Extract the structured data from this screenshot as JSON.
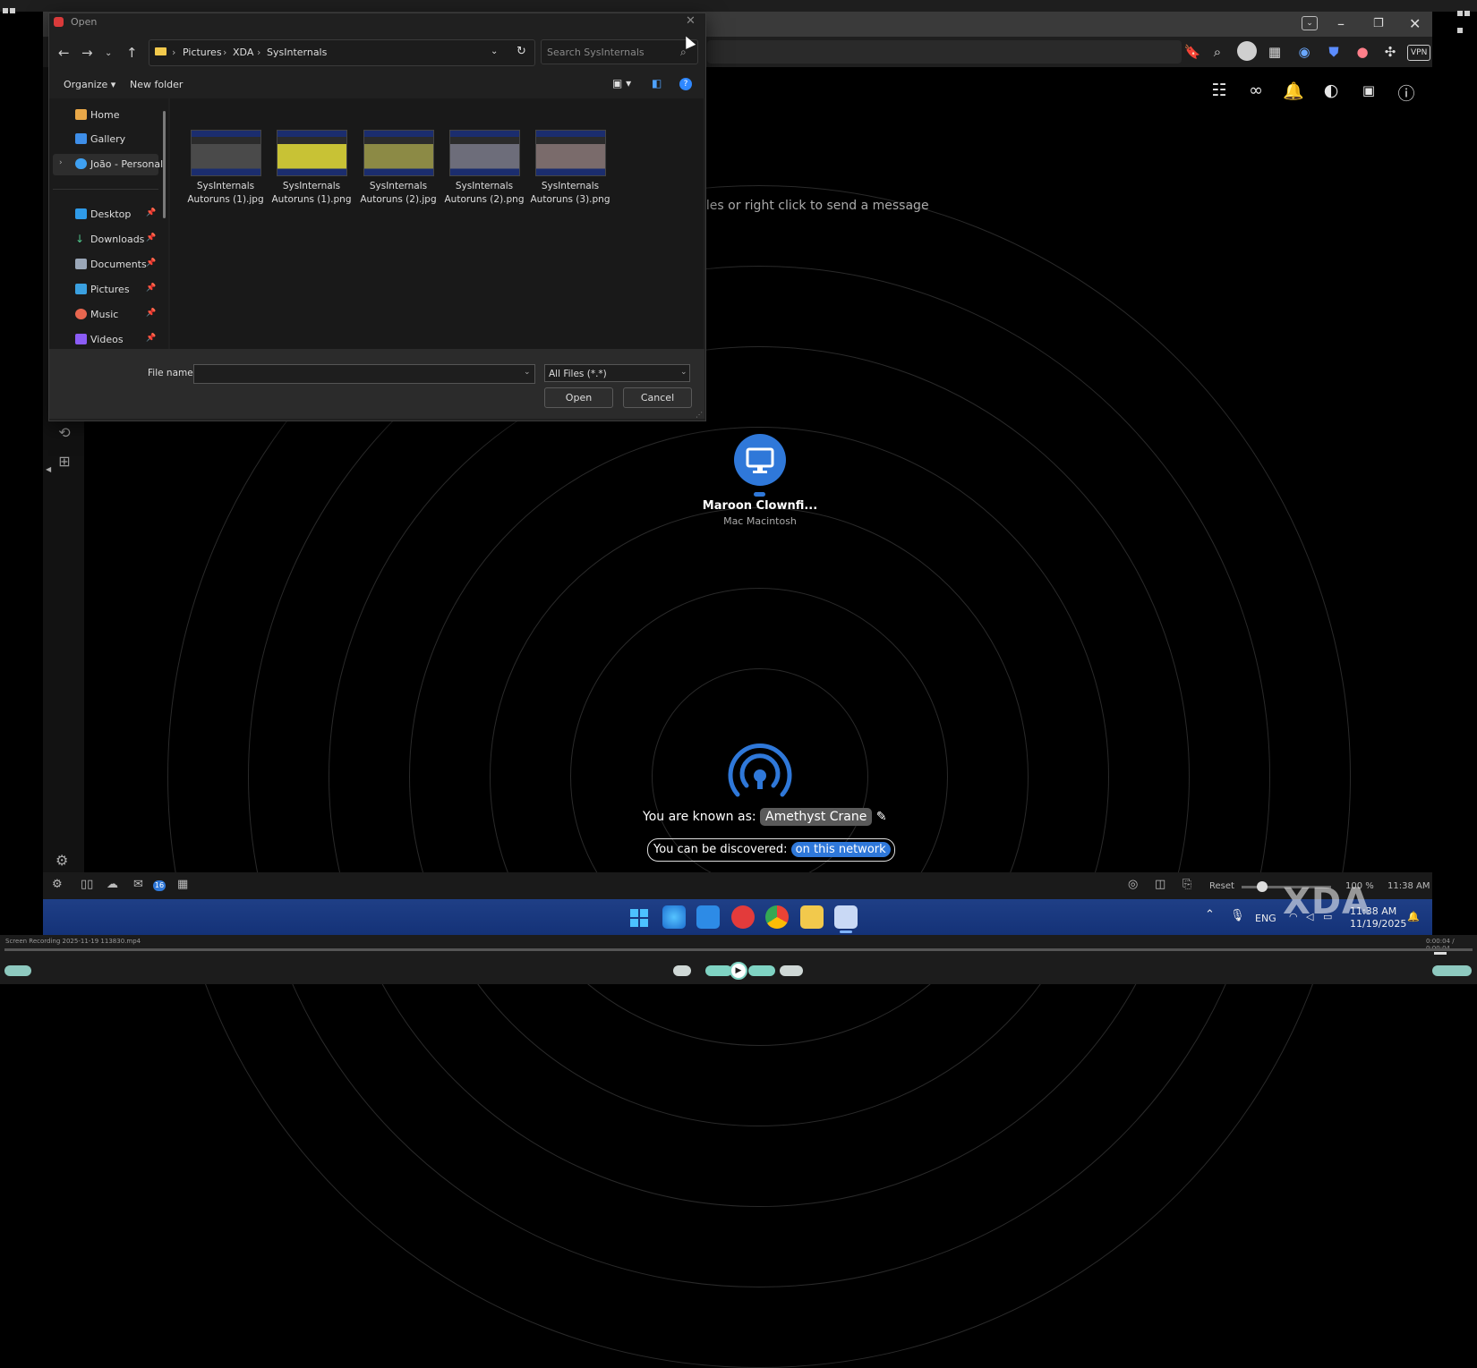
{
  "dialog": {
    "title": "Open",
    "breadcrumb": [
      "Pictures",
      "XDA",
      "SysInternals"
    ],
    "search_placeholder": "Search SysInternals",
    "organize_label": "Organize",
    "new_folder_label": "New folder",
    "nav_items": [
      {
        "label": "Home",
        "icon": "home-icon",
        "pinned": false
      },
      {
        "label": "Gallery",
        "icon": "gallery-icon",
        "pinned": false
      },
      {
        "label": "João - Personal",
        "icon": "cloud-icon",
        "pinned": false
      },
      {
        "label": "Desktop",
        "icon": "desktop-icon",
        "pinned": true
      },
      {
        "label": "Downloads",
        "icon": "download-icon",
        "pinned": true
      },
      {
        "label": "Documents",
        "icon": "document-icon",
        "pinned": true
      },
      {
        "label": "Pictures",
        "icon": "pictures-icon",
        "pinned": true
      },
      {
        "label": "Music",
        "icon": "music-icon",
        "pinned": true
      },
      {
        "label": "Videos",
        "icon": "videos-icon",
        "pinned": true
      }
    ],
    "files": [
      {
        "line1": "SysInternals",
        "line2": "Autoruns (1).jpg"
      },
      {
        "line1": "SysInternals",
        "line2": "Autoruns (1).png"
      },
      {
        "line1": "SysInternals",
        "line2": "Autoruns (2).jpg"
      },
      {
        "line1": "SysInternals",
        "line2": "Autoruns (2).png"
      },
      {
        "line1": "SysInternals",
        "line2": "Autoruns (3).png"
      }
    ],
    "filename_label": "File name:",
    "filename_value": "",
    "filetype_value": "All Files (*.*)",
    "open_label": "Open",
    "cancel_label": "Cancel"
  },
  "app": {
    "hint": "iles or right click to send a message",
    "device": {
      "name": "Maroon Clownfi...",
      "type": "Mac Macintosh"
    },
    "known_as_label": "You are known as:",
    "known_as_name": "Amethyst Crane",
    "discover_label": "You can be discovered:",
    "discover_value": "on this network"
  },
  "browser": {
    "vpn_label": "VPN"
  },
  "statusbar": {
    "mail_badge": "16",
    "reset_label": "Reset",
    "zoom": "100 %",
    "time": "11:38 AM"
  },
  "taskbar": {
    "lang": "ENG",
    "time": "11:38 AM",
    "date": "11/19/2025"
  },
  "player": {
    "filename": "Screen Recording 2025-11-19 113830.mp4",
    "timecode": "0:00:04 / 0:00:04"
  },
  "watermark": "XDA",
  "colors": {
    "accent": "#2f78d9",
    "taskbar": "#1b3a80"
  }
}
